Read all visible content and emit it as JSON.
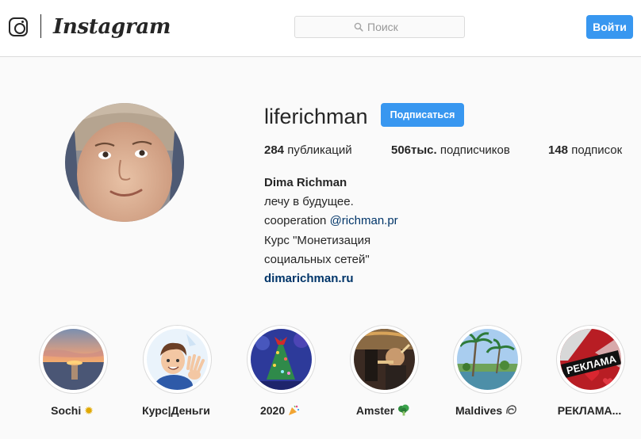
{
  "nav": {
    "brand": "Instagram",
    "search_placeholder": "Поиск",
    "login_label": "Войти"
  },
  "profile": {
    "username": "liferichman",
    "follow_label": "Подписаться",
    "stats": {
      "posts_count": "284",
      "posts_label": "публикаций",
      "followers_count": "506тыс.",
      "followers_label": "подписчиков",
      "following_count": "148",
      "following_label": "подписок"
    },
    "bio": {
      "full_name": "Dima Richman",
      "line1": "лечу в будущее.",
      "cooperation_prefix": "cooperation",
      "mention": "@richman.pr",
      "line3": "Курс \"Монетизация",
      "line4": "социальных сетей\"",
      "website": "dimarichman.ru"
    }
  },
  "highlights": [
    {
      "title": "Sochi",
      "icon": "sun-emoji"
    },
    {
      "title": "Курс|Деньги",
      "icon": ""
    },
    {
      "title": "2020",
      "icon": "party-popper-emoji"
    },
    {
      "title": "Amster",
      "icon": "broccoli-emoji"
    },
    {
      "title": "Maldives",
      "icon": "shell-emoji"
    },
    {
      "title": "РЕКЛАМА...",
      "icon": "",
      "badge_text": "РЕКЛАМА"
    }
  ],
  "colors": {
    "accent": "#3897f0",
    "link": "#003569",
    "background": "#fafafa",
    "border": "#dbdbdb"
  }
}
